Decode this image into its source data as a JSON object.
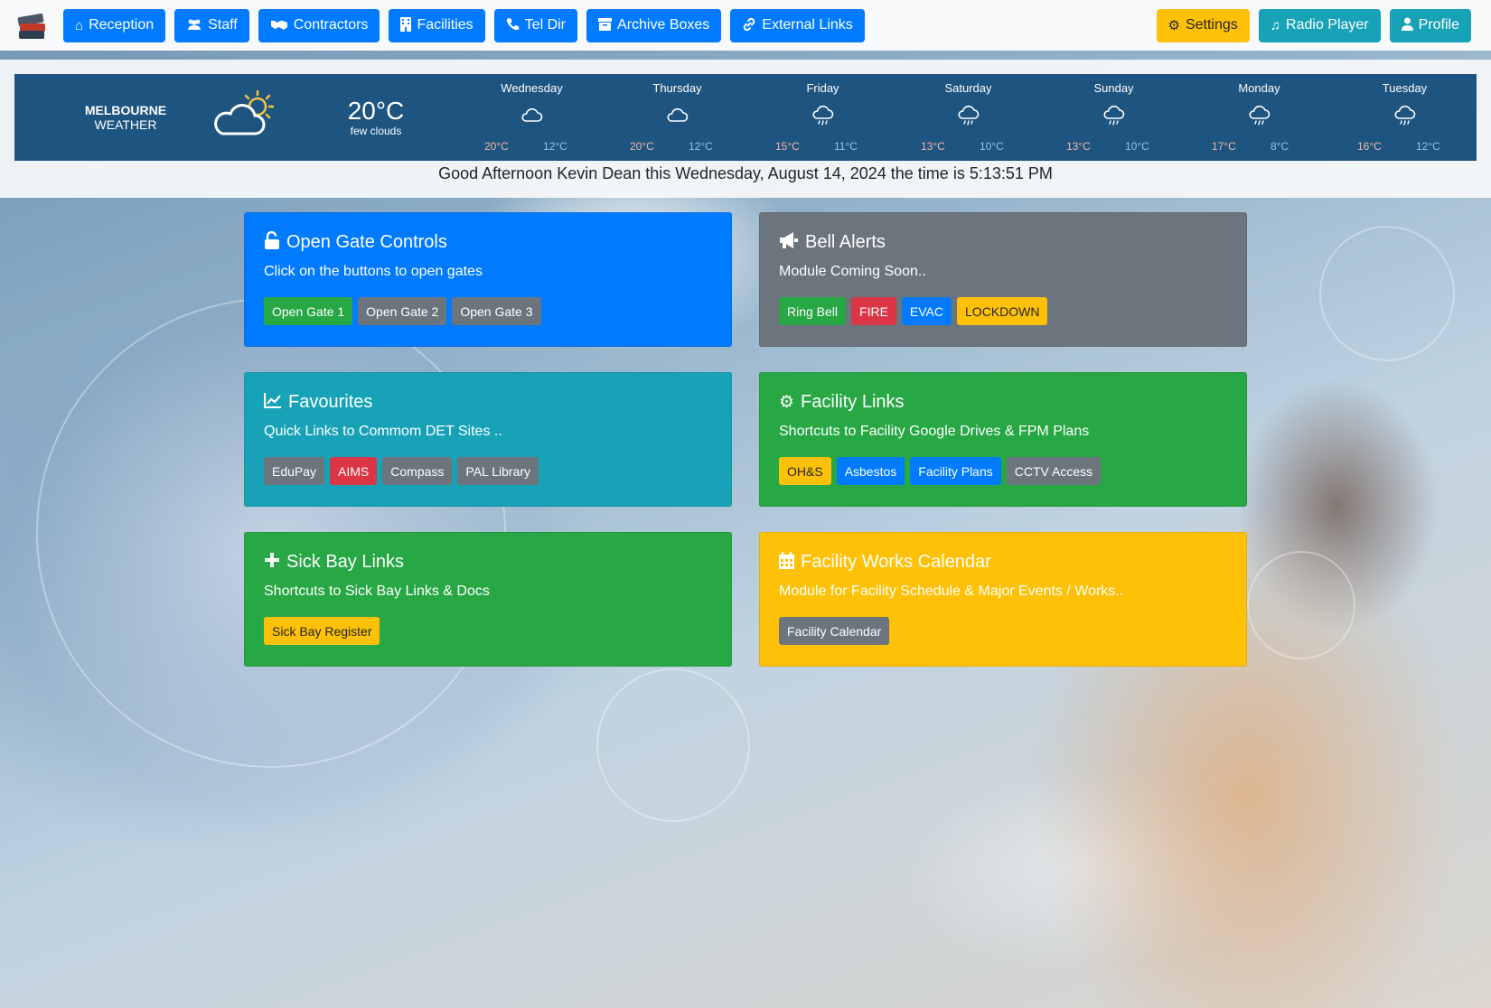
{
  "navbar": {
    "left": [
      {
        "label": "Reception",
        "icon": "home-icon"
      },
      {
        "label": "Staff",
        "icon": "users-icon"
      },
      {
        "label": "Contractors",
        "icon": "handshake-icon"
      },
      {
        "label": "Facilities",
        "icon": "building-icon"
      },
      {
        "label": "Tel Dir",
        "icon": "phone-icon"
      },
      {
        "label": "Archive Boxes",
        "icon": "archive-icon"
      },
      {
        "label": "External Links",
        "icon": "link-icon"
      }
    ],
    "right": [
      {
        "label": "Settings",
        "icon": "cogs-icon",
        "color": "#ffc107"
      },
      {
        "label": "Radio Player",
        "icon": "music-icon",
        "color": "#17a2b8"
      },
      {
        "label": "Profile",
        "icon": "user-icon",
        "color": "#17a2b8"
      }
    ]
  },
  "weather": {
    "city": "MELBOURNE",
    "label": "WEATHER",
    "current_temp": "20°C",
    "current_desc": "few clouds",
    "current_icon": "partly-cloudy-icon",
    "forecast": [
      {
        "day": "Wednesday",
        "hi": "20°C",
        "lo": "12°C",
        "icon": "cloud-icon"
      },
      {
        "day": "Thursday",
        "hi": "20°C",
        "lo": "12°C",
        "icon": "cloud-icon"
      },
      {
        "day": "Friday",
        "hi": "15°C",
        "lo": "11°C",
        "icon": "rain-cloud-icon"
      },
      {
        "day": "Saturday",
        "hi": "13°C",
        "lo": "10°C",
        "icon": "rain-cloud-icon"
      },
      {
        "day": "Sunday",
        "hi": "13°C",
        "lo": "10°C",
        "icon": "rain-cloud-icon"
      },
      {
        "day": "Monday",
        "hi": "17°C",
        "lo": "8°C",
        "icon": "rain-cloud-icon"
      },
      {
        "day": "Tuesday",
        "hi": "16°C",
        "lo": "12°C",
        "icon": "rain-cloud-icon"
      }
    ]
  },
  "greeting": "Good Afternoon Kevin Dean this Wednesday, August 14, 2024 the time is 5:13:51 PM",
  "cards": [
    {
      "title": "Open Gate Controls",
      "icon": "unlock-icon",
      "color": "#007bff",
      "text": "Click on the buttons to open gates",
      "buttons": [
        {
          "label": "Open Gate 1",
          "color": "#28a745"
        },
        {
          "label": "Open Gate 2",
          "color": "#6c757d"
        },
        {
          "label": "Open Gate 3",
          "color": "#6c757d"
        }
      ]
    },
    {
      "title": "Bell Alerts",
      "icon": "bullhorn-icon",
      "color": "#6c757d",
      "text": "Module Coming Soon..",
      "buttons": [
        {
          "label": "Ring Bell",
          "color": "#28a745"
        },
        {
          "label": "FIRE",
          "color": "#dc3545"
        },
        {
          "label": "EVAC",
          "color": "#007bff"
        },
        {
          "label": "LOCKDOWN",
          "color": "#ffc107"
        }
      ]
    },
    {
      "title": "Favourites",
      "icon": "chart-line-icon",
      "color": "#17a2b8",
      "text": "Quick Links to Commom DET Sites ..",
      "buttons": [
        {
          "label": "EduPay",
          "color": "#6c757d"
        },
        {
          "label": "AIMS",
          "color": "#dc3545"
        },
        {
          "label": "Compass",
          "color": "#6c757d"
        },
        {
          "label": "PAL Library",
          "color": "#6c757d"
        }
      ]
    },
    {
      "title": "Facility Links",
      "icon": "cog-icon",
      "color": "#28a745",
      "text": "Shortcuts to Facility Google Drives & FPM Plans",
      "buttons": [
        {
          "label": "OH&S",
          "color": "#ffc107"
        },
        {
          "label": "Asbestos",
          "color": "#007bff"
        },
        {
          "label": "Facility Plans",
          "color": "#007bff"
        },
        {
          "label": "CCTV Access",
          "color": "#6c757d"
        }
      ]
    },
    {
      "title": "Sick Bay Links",
      "icon": "plus-icon",
      "color": "#28a745",
      "text": "Shortcuts to Sick Bay Links & Docs",
      "buttons": [
        {
          "label": "Sick Bay Register",
          "color": "#ffc107"
        }
      ]
    },
    {
      "title": "Facility Works Calendar",
      "icon": "calendar-icon",
      "color": "#ffc107",
      "text": "Module for Facility Schedule & Major Events / Works..",
      "buttons": [
        {
          "label": "Facility Calendar",
          "color": "#6c757d"
        }
      ]
    }
  ]
}
